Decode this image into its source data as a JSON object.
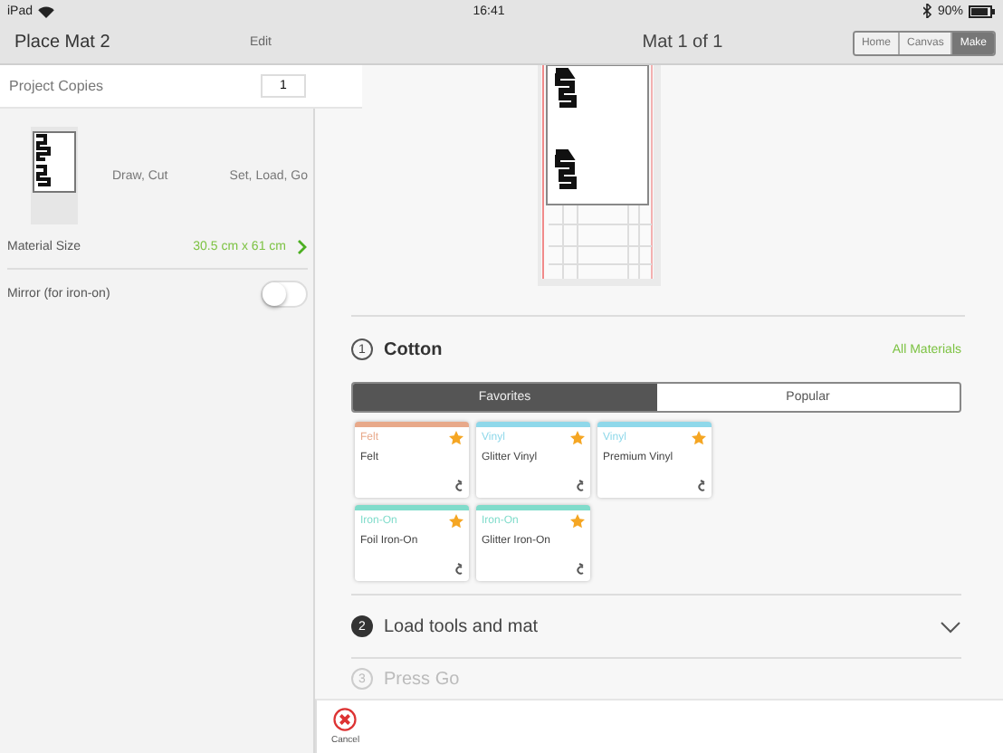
{
  "status_bar": {
    "device": "iPad",
    "time": "16:41",
    "battery": "90%"
  },
  "left_panel": {
    "title": "Place Mat 2",
    "edit": "Edit",
    "copies_label": "Project Copies",
    "copies": "1",
    "mat": {
      "operations": "Draw, Cut",
      "steps": "Set, Load, Go"
    },
    "material_size_label": "Material Size",
    "material_size": "30.5 cm x 61 cm",
    "mirror_label": "Mirror (for iron-on)",
    "mirror_on": false
  },
  "header": {
    "title": "Mat 1 of 1",
    "nav": [
      {
        "label": "Home",
        "selected": false
      },
      {
        "label": "Canvas",
        "selected": false
      },
      {
        "label": "Make",
        "selected": true
      }
    ]
  },
  "steps": [
    {
      "number": "1",
      "title": "Cotton",
      "done": true,
      "current": false,
      "link": "All Materials"
    },
    {
      "number": "2",
      "title": "Load tools and mat",
      "done": false,
      "current": true
    },
    {
      "number": "3",
      "title": "Press Go",
      "done": false,
      "current": false
    }
  ],
  "material_tabs": [
    {
      "label": "Favorites",
      "selected": true
    },
    {
      "label": "Popular",
      "selected": false
    }
  ],
  "materials": [
    {
      "category": "Felt",
      "name": "Felt",
      "color": "#e8a98a",
      "favorite": true
    },
    {
      "category": "Vinyl",
      "name": "Glitter Vinyl",
      "color": "#8fd8ea",
      "favorite": true
    },
    {
      "category": "Vinyl",
      "name": "Premium Vinyl",
      "color": "#8fd8ea",
      "favorite": true
    },
    {
      "category": "Iron-On",
      "name": "Foil Iron-On",
      "color": "#80dccb",
      "favorite": true
    },
    {
      "category": "Iron-On",
      "name": "Glitter Iron-On",
      "color": "#80dccb",
      "favorite": true
    }
  ],
  "bottom_bar": {
    "cancel": "Cancel"
  }
}
